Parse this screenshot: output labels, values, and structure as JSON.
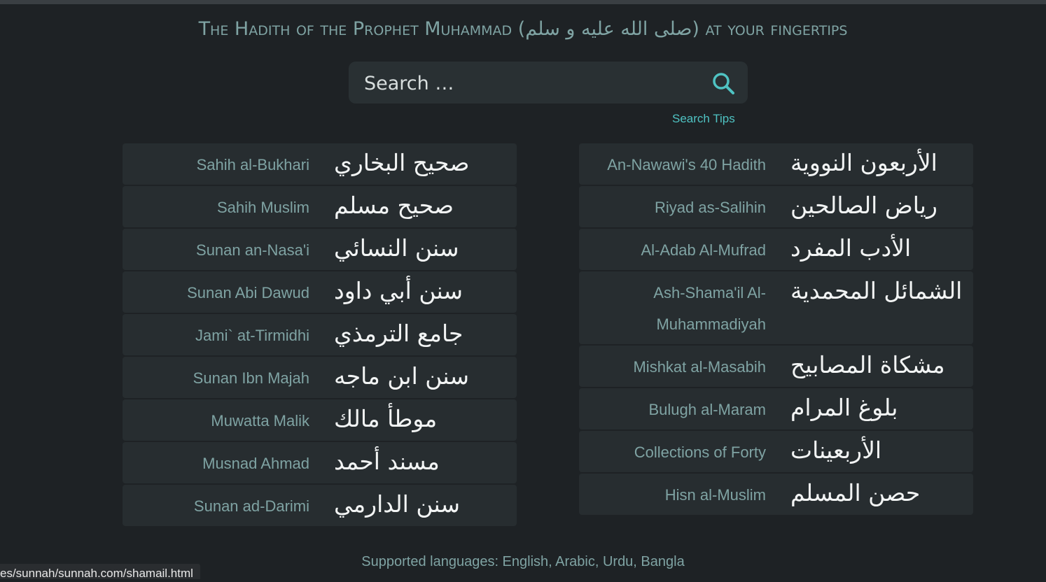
{
  "header": {
    "tagline_prefix": "The Hadith of the Prophet Muhammad (",
    "tagline_arabic": "صلى الله عليه و سلم",
    "tagline_suffix": ") at your fingertips"
  },
  "search": {
    "placeholder": "Search …",
    "tips_label": "Search Tips",
    "icon": "search-icon"
  },
  "collections_left": [
    {
      "en": "Sahih al-Bukhari",
      "ar": "صحيح البخاري"
    },
    {
      "en": "Sahih Muslim",
      "ar": "صحيح مسلم"
    },
    {
      "en": "Sunan an-Nasa'i",
      "ar": "سنن النسائي"
    },
    {
      "en": "Sunan Abi Dawud",
      "ar": "سنن أبي داود"
    },
    {
      "en": "Jami` at-Tirmidhi",
      "ar": "جامع الترمذي"
    },
    {
      "en": "Sunan Ibn Majah",
      "ar": "سنن ابن ماجه"
    },
    {
      "en": "Muwatta Malik",
      "ar": "موطأ مالك"
    },
    {
      "en": "Musnad Ahmad",
      "ar": "مسند أحمد"
    },
    {
      "en": "Sunan ad-Darimi",
      "ar": "سنن الدارمي"
    }
  ],
  "collections_right": [
    {
      "en": "An-Nawawi's 40 Hadith",
      "ar": "الأربعون النووية"
    },
    {
      "en": "Riyad as-Salihin",
      "ar": "رياض الصالحين"
    },
    {
      "en": "Al-Adab Al-Mufrad",
      "ar": "الأدب المفرد"
    },
    {
      "en": "Ash-Shama'il Al-Muhammadiyah",
      "ar": "الشمائل المحمدية"
    },
    {
      "en": "Mishkat al-Masabih",
      "ar": "مشكاة المصابيح"
    },
    {
      "en": "Bulugh al-Maram",
      "ar": "بلوغ المرام"
    },
    {
      "en": "Collections of Forty",
      "ar": "الأربعينات"
    },
    {
      "en": "Hisn al-Muslim",
      "ar": "حصن المسلم"
    }
  ],
  "footer": {
    "languages": "Supported languages: English, Arabic, Urdu, Bangla"
  },
  "statusbar": {
    "url": "es/sunnah/sunnah.com/shamail.html"
  },
  "colors": {
    "background": "#1e2225",
    "card": "#272d30",
    "muted_teal": "#7fa3a3",
    "link": "#4fc3c3"
  }
}
